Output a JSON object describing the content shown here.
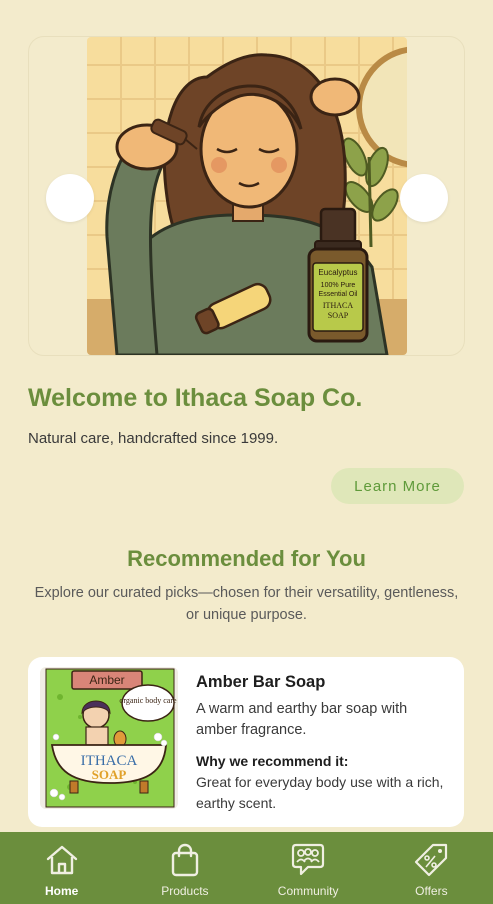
{
  "hero": {
    "image_alt": "Woman applying essential oil with dropper",
    "bottle_label_lines": [
      "Eucalyptus",
      "100% Pure",
      "Essential Oil",
      "ITHACA",
      "SOAP"
    ]
  },
  "welcome": {
    "title": "Welcome to Ithaca Soap Co.",
    "subtitle": "Natural care, handcrafted since 1999.",
    "cta_label": "Learn More"
  },
  "recommended": {
    "title": "Recommended for You",
    "subtitle": "Explore our curated picks—chosen for their versatility, gentleness, or unique purpose."
  },
  "products": [
    {
      "name": "Amber Bar Soap",
      "description": "A warm and earthy bar soap with amber fragrance.",
      "why_label": "Why we recommend it:",
      "reason": "Great for everyday body use with a rich, earthy scent.",
      "image_label_top": "Amber",
      "image_badge": "organic body care",
      "image_brand_1": "ITHACA",
      "image_brand_2": "SOAP"
    }
  ],
  "nav": {
    "items": [
      {
        "label": "Home",
        "icon": "home-icon",
        "active": true
      },
      {
        "label": "Products",
        "icon": "shopping-bag-icon",
        "active": false
      },
      {
        "label": "Community",
        "icon": "community-icon",
        "active": false
      },
      {
        "label": "Offers",
        "icon": "tag-icon",
        "active": false
      }
    ]
  },
  "colors": {
    "background": "#f3ebcc",
    "accent_green": "#6b8e3d",
    "cta_bg": "#dfe7b9",
    "card_bg": "#ffffff"
  }
}
